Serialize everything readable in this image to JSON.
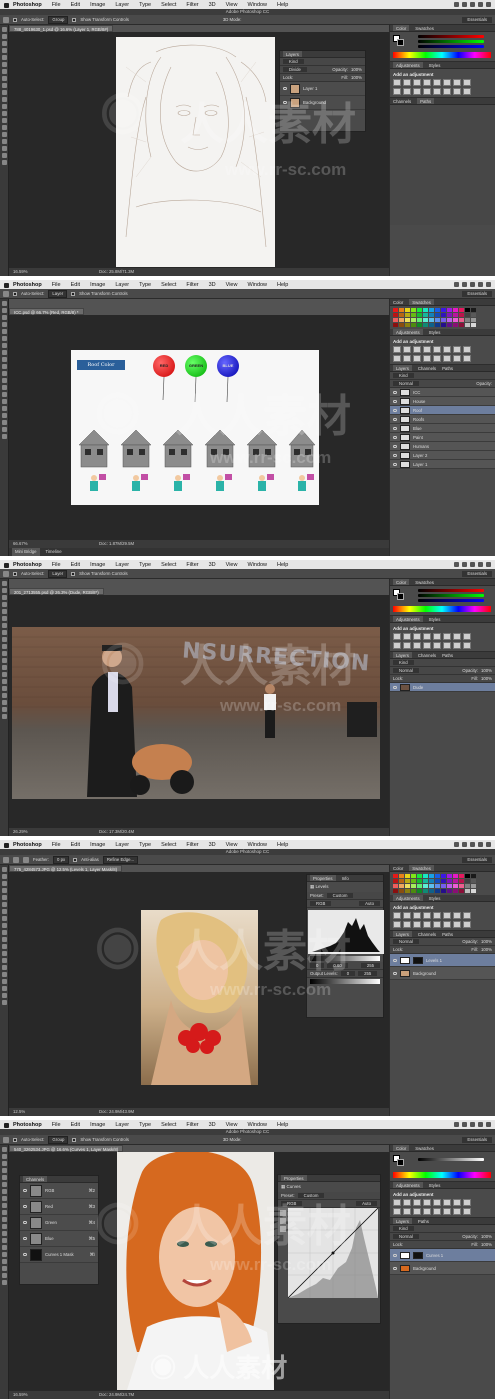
{
  "menubar": {
    "app": "Photoshop",
    "items": [
      "File",
      "Edit",
      "Image",
      "Layer",
      "Type",
      "Select",
      "Filter",
      "3D",
      "View",
      "Window",
      "Help"
    ]
  },
  "window_title": "Adobe Photoshop CC",
  "workspace": "Essentials",
  "options": {
    "auto_select": "Auto-Select:",
    "group": "Group",
    "layer": "Layer",
    "show_transform": "Show Transform Controls",
    "mode_3d": "3D Mode:",
    "feather": "Feather:",
    "feather_val": "0 px",
    "anti_alias": "Anti-alias",
    "refine": "Refine Edge..."
  },
  "panels": {
    "layers": "Layers",
    "channels": "Channels",
    "paths": "Paths",
    "adjustments": "Adjustments",
    "styles": "Styles",
    "add_adjustment": "Add an adjustment",
    "color": "Color",
    "swatches": "Swatches",
    "properties": "Properties",
    "info": "Info",
    "kind": "Kind",
    "normal": "Normal",
    "opacity": "Opacity:",
    "opacity_val": "100%",
    "lock": "Lock:",
    "fill": "Fill:",
    "fill_val": "100%"
  },
  "watermark": {
    "brand": "人人素材",
    "url": "www.rr-sc.com"
  },
  "s1": {
    "tab": "788_4019630_1.psd @ 16.6% (Layer 1, RGB/8#)",
    "zoom": "16.59%",
    "doc": "Doc: 25.8M/71.3M",
    "layers_title": "Layers",
    "blend": "Divide",
    "layers": [
      "Layer 1",
      "Background"
    ]
  },
  "s2": {
    "tab": "ICC.psd @ 66.7% (Red, RGB/8) *",
    "zoom": "66.67%",
    "doc": "Doc: 1.87M/29.5M",
    "bottom_tabs": [
      "Mini Bridge",
      "Timeline"
    ],
    "roof_label": "Roof Color",
    "balloons": [
      "RED",
      "GREEN",
      "BLUE"
    ],
    "layers": [
      "ICC",
      "House",
      "Roof",
      "Roofs",
      "Blue",
      "Paint",
      "Humans",
      "Layer 2",
      "Layer 1"
    ]
  },
  "s3": {
    "tab": "201_2713555.psd @ 26.3% (Dude, RGB/8*)",
    "zoom": "26.29%",
    "doc": "Doc: 17.3M/20.4M",
    "graffiti": "NSURRECTION",
    "layers": [
      "Dude"
    ]
  },
  "s4": {
    "tab": "775_4284573.JPG @ 12.5% (Levels 1, Layer Mask/8)",
    "zoom": "12.5%",
    "doc": "Doc: 24.9M/43.9M",
    "props_title": "Levels",
    "preset": "Preset:",
    "preset_val": "Custom",
    "channel": "RGB",
    "auto": "Auto",
    "input_vals": [
      "0",
      "0.60",
      "255"
    ],
    "output": "Output Levels:",
    "output_vals": [
      "0",
      "255"
    ],
    "layers": [
      "Levels 1",
      "Background"
    ]
  },
  "s5": {
    "tab": "540_3262534.JPG @ 16.6% (Curves 1, Layer Mask/8)",
    "zoom": "16.59%",
    "doc": "Doc: 24.9M/24.7M",
    "props_title": "Curves",
    "preset": "Preset:",
    "preset_val": "Custom",
    "channel": "RGB",
    "auto": "Auto",
    "channels_title": "Channels",
    "channels": [
      {
        "name": "RGB",
        "key": "⌘2"
      },
      {
        "name": "Red",
        "key": "⌘3"
      },
      {
        "name": "Green",
        "key": "⌘4"
      },
      {
        "name": "Blue",
        "key": "⌘5"
      },
      {
        "name": "Curves 1 Mask",
        "key": "⌘\\"
      }
    ],
    "layers": [
      "Curves 1",
      "Background"
    ]
  }
}
